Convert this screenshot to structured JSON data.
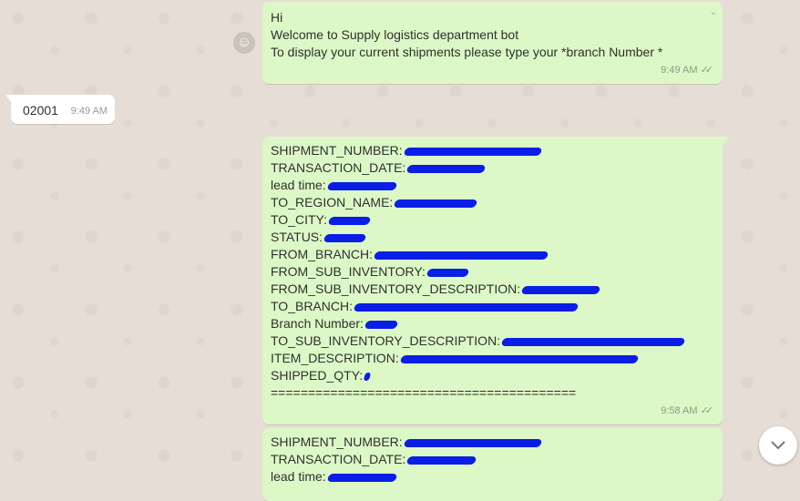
{
  "messages": [
    {
      "lines": [
        "Hi",
        " Welcome to Supply logistics department bot",
        " To display your current shipments please type your *branch Number *"
      ],
      "time": "9:49 AM"
    },
    {
      "text": "02001",
      "time": "9:49 AM"
    },
    {
      "fields": [
        "SHIPMENT_NUMBER:",
        "TRANSACTION_DATE:",
        "lead time:",
        "TO_REGION_NAME:",
        "TO_CITY:",
        "STATUS:",
        "FROM_BRANCH:",
        "FROM_SUB_INVENTORY:",
        "FROM_SUB_INVENTORY_DESCRIPTION:",
        "TO_BRANCH:",
        "Branch Number:",
        "TO_SUB_INVENTORY_DESCRIPTION:",
        "ITEM_DESCRIPTION:",
        "SHIPPED_QTY:"
      ],
      "separator": "=========================================",
      "time": "9:58 AM"
    },
    {
      "fields": [
        "SHIPMENT_NUMBER:",
        "TRANSACTION_DATE:",
        "lead time:"
      ]
    }
  ],
  "icons": {
    "emoji": "smiley-icon",
    "scroll": "chevron-down-icon",
    "read_receipt": "double-check-icon"
  },
  "colors": {
    "outgoing_bubble": "#dcf8c6",
    "incoming_bubble": "#ffffff",
    "background": "#e6ded6",
    "redaction": "#0a1ee6"
  }
}
